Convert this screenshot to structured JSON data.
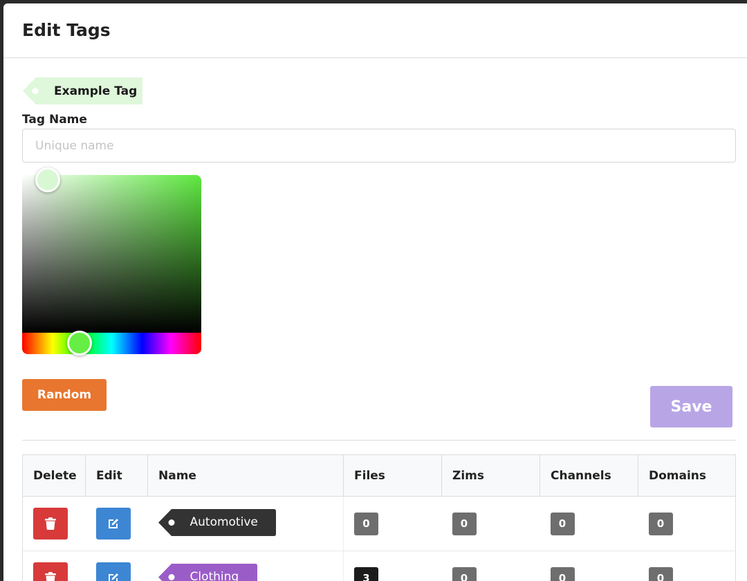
{
  "modal": {
    "title": "Edit Tags",
    "example_tag": {
      "label": "Example Tag",
      "color": "#dff7db"
    },
    "tag_name": {
      "label": "Tag Name",
      "placeholder": "Unique name",
      "value": ""
    },
    "color_picker": {
      "selected_color": "#d8f7d3",
      "hue_color": "#66ee44"
    },
    "random_label": "Random",
    "save_label": "Save"
  },
  "table": {
    "headers": [
      "Delete",
      "Edit",
      "Name",
      "Files",
      "Zims",
      "Channels",
      "Domains"
    ],
    "rows": [
      {
        "name": "Automotive",
        "color": "#333333",
        "files": "0",
        "zims": "0",
        "channels": "0",
        "domains": "0"
      },
      {
        "name": "Clothing",
        "color": "#9a5dc8",
        "files": "3",
        "zims": "0",
        "channels": "0",
        "domains": "0"
      }
    ]
  }
}
